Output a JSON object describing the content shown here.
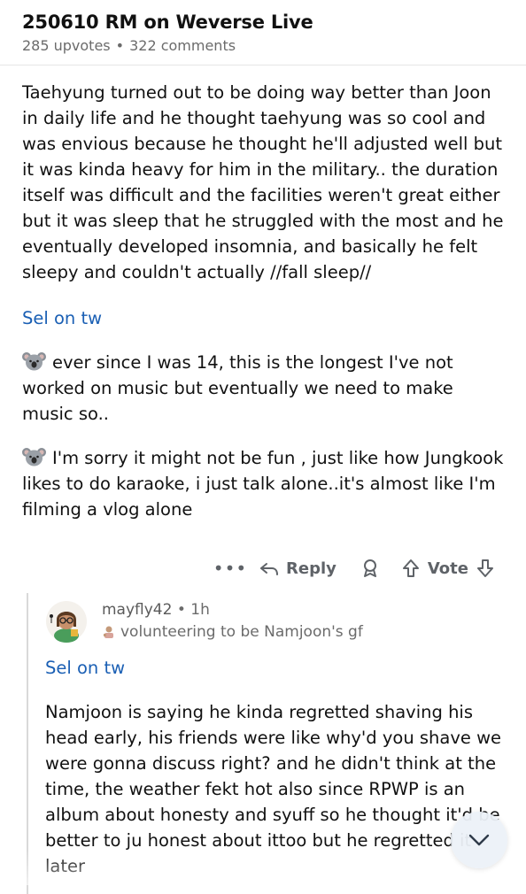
{
  "post": {
    "title": "250610 RM on Weverse Live",
    "upvotes": "285 upvotes",
    "separator": "•",
    "comments": "322 comments",
    "paragraph_1": "Taehyung turned out to be doing way better than Joon in daily life and he thought taehyung was so cool and was envious because he thought he'll adjusted well but it was kinda heavy for him in the military.. the duration itself was difficult and the facilities weren't great either but it was sleep that he struggled with the most and he eventually developed insomnia, and basically he felt sleepy and couldn't actually //fall sleep//",
    "source_link": "Sel on tw",
    "quote_1_text": "ever since I was 14, this is the longest I've not worked on music but eventually we need to make music so..",
    "quote_2_text": "I'm sorry it might not be fun , just like how Jungkook likes to do karaoke, i just talk alone..it's almost like I'm filming a vlog alone",
    "quote_icon": "koala-emoji-icon"
  },
  "actions": {
    "more": "•••",
    "reply": "Reply",
    "vote": "Vote"
  },
  "comment": {
    "username": "mayfly42",
    "separator": "•",
    "time": "1h",
    "flair": "volunteering to be Namjoon's gf",
    "source_link": "Sel on tw",
    "body": "Namjoon is saying he kinda regretted shaving his head early, his friends were like why'd you shave we were gonna discuss right? and he didn't think at the time, the weather fekt hot also since RPWP is an album about honesty and syuff so he thought it'd be better to ju honest about ittoo but he regretted it later"
  },
  "colors": {
    "link": "#1a5fb4",
    "meta": "#6b6b6b",
    "text": "#111111"
  }
}
